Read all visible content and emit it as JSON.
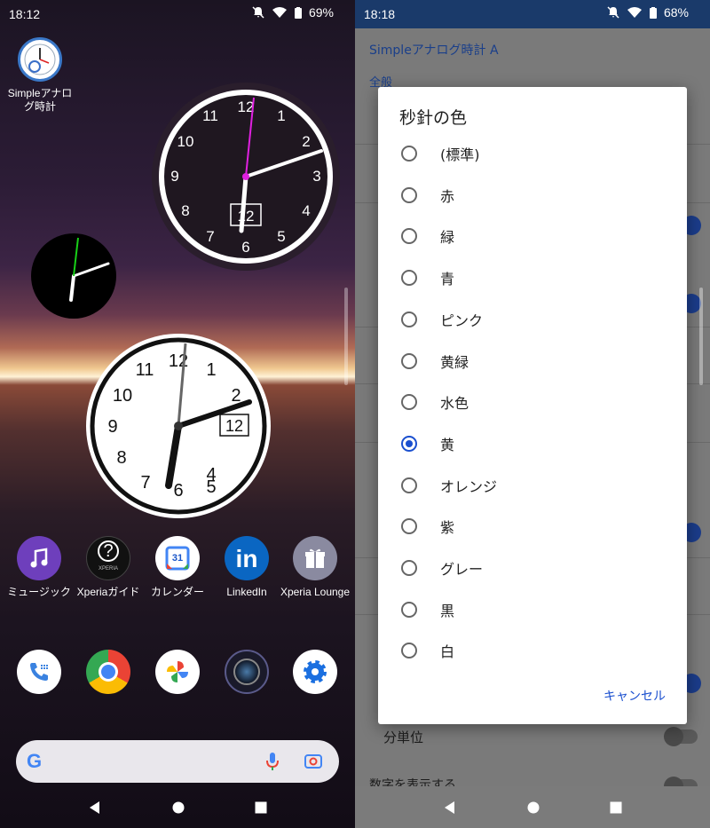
{
  "left": {
    "status": {
      "time": "18:12",
      "battery": "69%"
    },
    "widget_app": {
      "label": "Simpleアナログ時計"
    },
    "clock_large": {
      "date": "12"
    },
    "clock_white": {
      "date": "12"
    },
    "apps": [
      {
        "label": "ミュージック"
      },
      {
        "label": "Xperiaガイド"
      },
      {
        "label": "カレンダー"
      },
      {
        "label": "LinkedIn"
      },
      {
        "label": "Xperia Lounge"
      }
    ],
    "clock_numbers": [
      "12",
      "1",
      "2",
      "3",
      "4",
      "5",
      "6",
      "7",
      "8",
      "9",
      "10",
      "11"
    ],
    "calendar_day": "31",
    "xperia_small": "XPERIA"
  },
  "right": {
    "status": {
      "time": "18:18",
      "battery": "68%"
    },
    "settings": {
      "app_title": "Simpleアナログ時計 A",
      "section_general": "全般",
      "row_minute": "分単位",
      "row_number_partial": "数字を表示する"
    },
    "dialog": {
      "title": "秒針の色",
      "options": [
        "(標準)",
        "赤",
        "緑",
        "青",
        "ピンク",
        "黄緑",
        "水色",
        "黄",
        "オレンジ",
        "紫",
        "グレー",
        "黒",
        "白"
      ],
      "selected_index": 7,
      "cancel": "キャンセル"
    }
  },
  "colors": {
    "accent": "#1a4fcf",
    "second_hand_magenta": "#e020e0"
  }
}
